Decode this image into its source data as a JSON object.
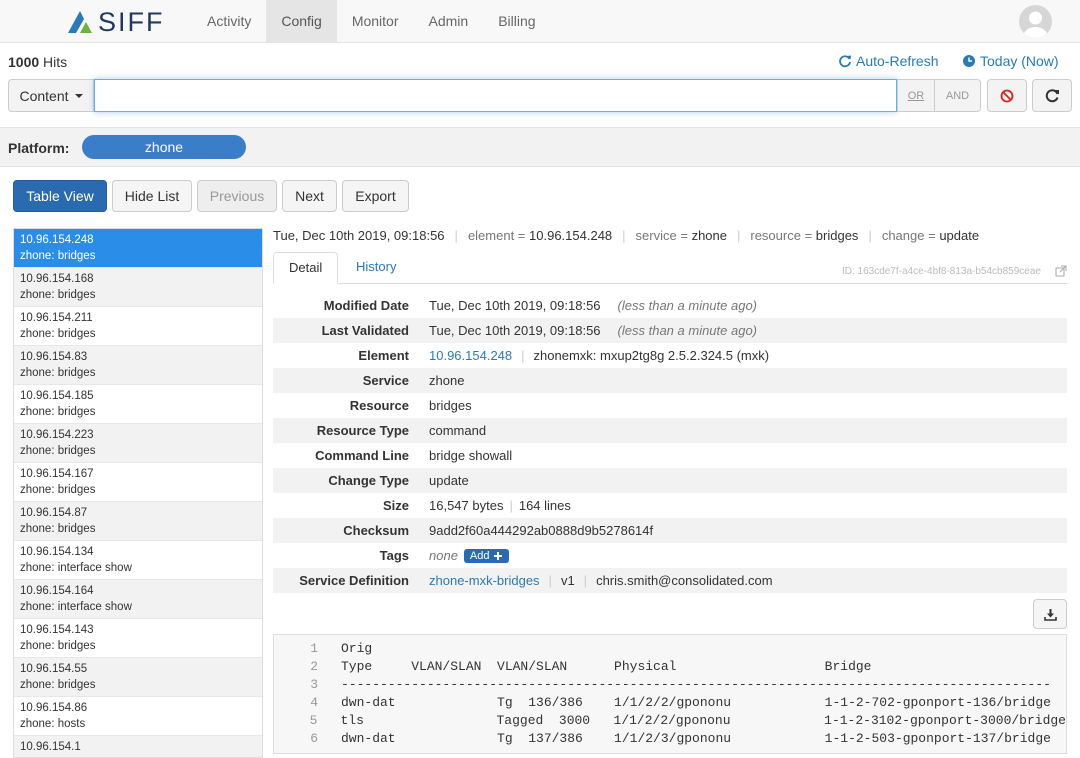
{
  "app": {
    "logo_text": "SIFF",
    "nav": [
      {
        "label": "Activity",
        "active": false
      },
      {
        "label": "Config",
        "active": true
      },
      {
        "label": "Monitor",
        "active": false
      },
      {
        "label": "Admin",
        "active": false
      },
      {
        "label": "Billing",
        "active": false
      }
    ]
  },
  "hits": {
    "count": "1000",
    "label": "Hits"
  },
  "toolbar": {
    "auto_refresh": "Auto-Refresh",
    "time_range": "Today (Now)",
    "content_label": "Content",
    "search_value": "",
    "or_label": "OR",
    "and_label": "AND"
  },
  "platform": {
    "label": "Platform:",
    "value": "zhone"
  },
  "actions": {
    "table_view": "Table View",
    "hide_list": "Hide List",
    "previous": "Previous",
    "next": "Next",
    "export": "Export"
  },
  "list_items": [
    {
      "ip": "10.96.154.248",
      "desc": "zhone: bridges",
      "selected": true
    },
    {
      "ip": "10.96.154.168",
      "desc": "zhone: bridges"
    },
    {
      "ip": "10.96.154.211",
      "desc": "zhone: bridges"
    },
    {
      "ip": "10.96.154.83",
      "desc": "zhone: bridges"
    },
    {
      "ip": "10.96.154.185",
      "desc": "zhone: bridges"
    },
    {
      "ip": "10.96.154.223",
      "desc": "zhone: bridges"
    },
    {
      "ip": "10.96.154.167",
      "desc": "zhone: bridges"
    },
    {
      "ip": "10.96.154.87",
      "desc": "zhone: bridges"
    },
    {
      "ip": "10.96.154.134",
      "desc": "zhone: interface show"
    },
    {
      "ip": "10.96.154.164",
      "desc": "zhone: interface show"
    },
    {
      "ip": "10.96.154.143",
      "desc": "zhone: bridges"
    },
    {
      "ip": "10.96.154.55",
      "desc": "zhone: bridges"
    },
    {
      "ip": "10.96.154.86",
      "desc": "zhone: hosts"
    },
    {
      "ip": "10.96.154.1",
      "desc": ""
    }
  ],
  "meta": {
    "timestamp": "Tue, Dec 10th 2019, 09:18:56",
    "element_key": "element =",
    "element_val": "10.96.154.248",
    "service_key": "service =",
    "service_val": "zhone",
    "resource_key": "resource =",
    "resource_val": "bridges",
    "change_key": "change =",
    "change_val": "update"
  },
  "tabs": {
    "detail": "Detail",
    "history": "History",
    "id": "ID: 163cde7f-a4ce-4bf8-813a-b54cb859ceae"
  },
  "details": {
    "modified_date": {
      "key": "Modified Date",
      "value": "Tue, Dec 10th 2019, 09:18:56",
      "note": "(less than a minute ago)"
    },
    "last_validated": {
      "key": "Last Validated",
      "value": "Tue, Dec 10th 2019, 09:18:56",
      "note": "(less than a minute ago)"
    },
    "element": {
      "key": "Element",
      "link": "10.96.154.248",
      "extra": "zhonemxk: mxup2tg8g 2.5.2.324.5 (mxk)"
    },
    "service": {
      "key": "Service",
      "value": "zhone"
    },
    "resource": {
      "key": "Resource",
      "value": "bridges"
    },
    "resource_type": {
      "key": "Resource Type",
      "value": "command"
    },
    "command_line": {
      "key": "Command Line",
      "value": "bridge showall"
    },
    "change_type": {
      "key": "Change Type",
      "value": "update"
    },
    "size": {
      "key": "Size",
      "bytes": "16,547 bytes",
      "lines": "164 lines"
    },
    "checksum": {
      "key": "Checksum",
      "value": "9add2f60a444292ab0888d9b5278614f"
    },
    "tags": {
      "key": "Tags",
      "value": "none",
      "add": "Add"
    },
    "service_definition": {
      "key": "Service Definition",
      "link": "zhone-mxk-bridges",
      "version": "v1",
      "user": "chris.smith@consolidated.com"
    }
  },
  "code": [
    {
      "n": "1",
      "t": "Orig"
    },
    {
      "n": "2",
      "t": "Type     VLAN/SLAN  VLAN/SLAN      Physical                   Bridge"
    },
    {
      "n": "3",
      "t": "-------------------------------------------------------------------------------------------"
    },
    {
      "n": "4",
      "t": "dwn-dat             Tg  136/386    1/1/2/2/gpononu            1-1-2-702-gponport-136/bridge"
    },
    {
      "n": "5",
      "t": "tls                 Tagged  3000   1/1/2/2/gpononu            1-1-2-3102-gponport-3000/bridge"
    },
    {
      "n": "6",
      "t": "dwn-dat             Tg  137/386    1/1/2/3/gpononu            1-1-2-503-gponport-137/bridge"
    }
  ],
  "colors": {
    "accent": "#2a7ab8",
    "primary": "#2a6ab0",
    "selected": "#2a8ee8",
    "pill": "#3a7dc9"
  }
}
